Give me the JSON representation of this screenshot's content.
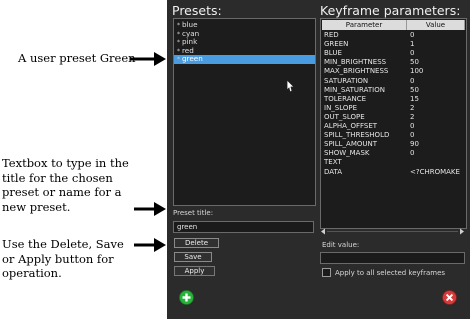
{
  "annotations": {
    "user_preset": "A user preset Green",
    "textbox_lines": [
      "Textbox to type in the",
      "title for the chosen",
      "preset or name for a",
      "new preset."
    ],
    "buttons_lines": [
      "Use the Delete, Save",
      "or Apply button for",
      "operation."
    ]
  },
  "presets": {
    "title": "Presets:",
    "items": [
      {
        "label": "blue",
        "selected": false
      },
      {
        "label": "cyan",
        "selected": false
      },
      {
        "label": "pink",
        "selected": false
      },
      {
        "label": "red",
        "selected": false
      },
      {
        "label": "green",
        "selected": true
      }
    ],
    "preset_title_label": "Preset title:",
    "preset_title_value": "green",
    "delete_label": "Delete",
    "save_label": "Save",
    "apply_label": "Apply"
  },
  "keyframe": {
    "title": "Keyframe parameters:",
    "col_parameter": "Parameter",
    "col_value": "Value",
    "rows": [
      {
        "name": "RED",
        "value": "0"
      },
      {
        "name": "GREEN",
        "value": "1"
      },
      {
        "name": "BLUE",
        "value": "0"
      },
      {
        "name": "MIN_BRIGHTNESS",
        "value": "50"
      },
      {
        "name": "MAX_BRIGHTNESS",
        "value": "100"
      },
      {
        "name": "SATURATION",
        "value": "0"
      },
      {
        "name": "MIN_SATURATION",
        "value": "50"
      },
      {
        "name": "TOLERANCE",
        "value": "15"
      },
      {
        "name": "IN_SLOPE",
        "value": "2"
      },
      {
        "name": "OUT_SLOPE",
        "value": "2"
      },
      {
        "name": "ALPHA_OFFSET",
        "value": "0"
      },
      {
        "name": "SPILL_THRESHOLD",
        "value": "0"
      },
      {
        "name": "SPILL_AMOUNT",
        "value": "90"
      },
      {
        "name": "SHOW_MASK",
        "value": "0"
      },
      {
        "name": "TEXT",
        "value": ""
      },
      {
        "name": "DATA",
        "value": "<?CHROMAKE"
      }
    ],
    "edit_value_label": "Edit value:",
    "edit_value": "",
    "apply_all_label": "Apply to all selected keyframes",
    "apply_all_checked": false
  },
  "icons": {
    "add": "plus-circle-icon",
    "close": "x-circle-icon"
  },
  "colors": {
    "panel_bg": "#2b2b2b",
    "selection": "#4a9ce0",
    "add_icon": "#27b23a",
    "close_icon": "#d63a3a"
  }
}
